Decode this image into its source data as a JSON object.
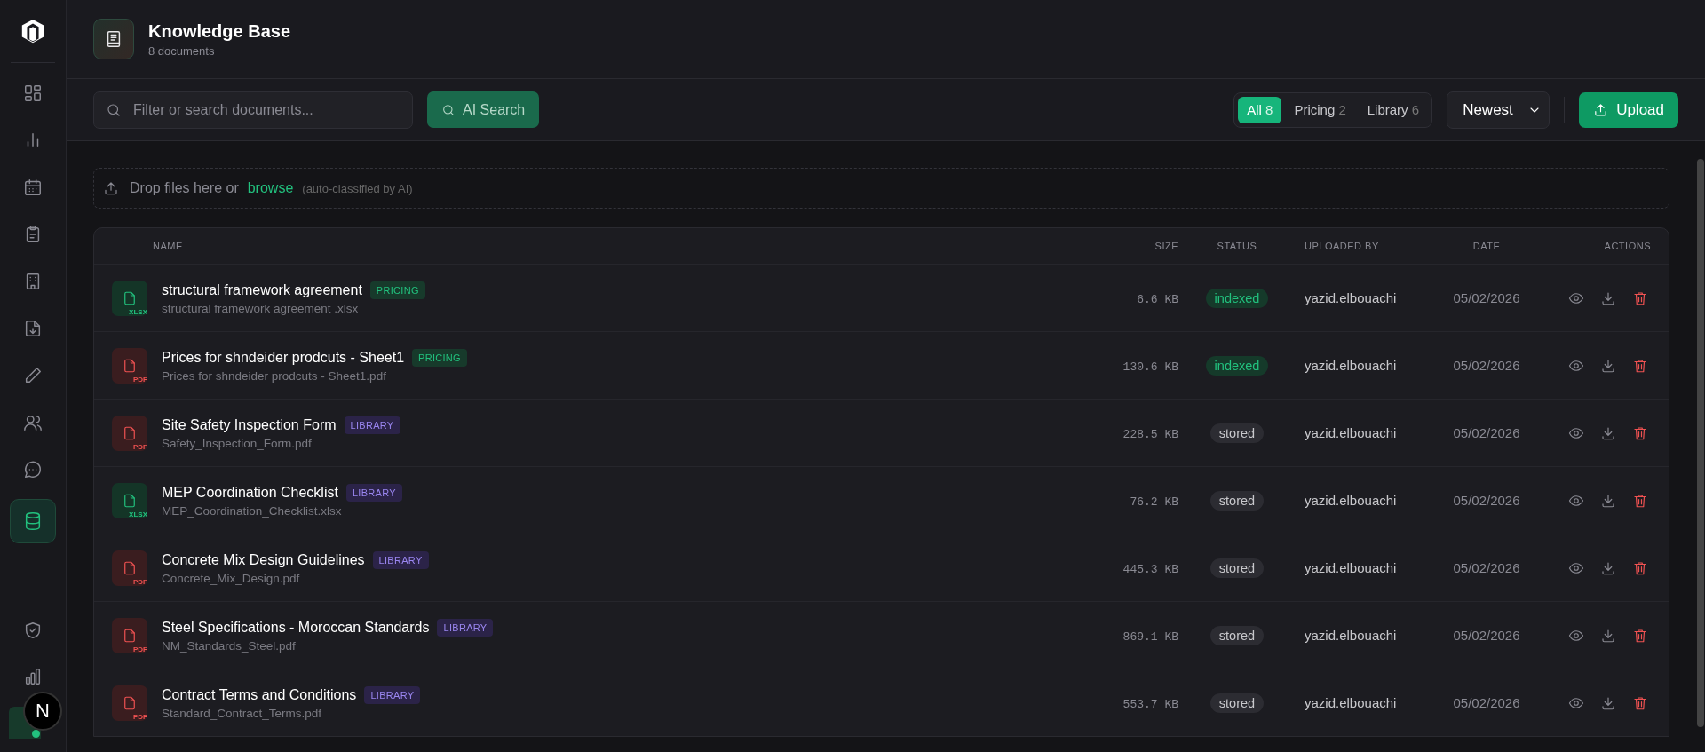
{
  "sidebar": {
    "items": [
      {
        "selected": false
      },
      {
        "selected": false
      },
      {
        "selected": false
      },
      {
        "selected": false
      },
      {
        "selected": false
      },
      {
        "selected": false
      },
      {
        "selected": false
      },
      {
        "selected": false
      },
      {
        "selected": false
      },
      {
        "selected": true
      }
    ],
    "bottom_items": [
      {
        "selected": false
      },
      {
        "selected": false
      }
    ],
    "avatar": {
      "initial": "N"
    }
  },
  "header": {
    "title": "Knowledge Base",
    "subtitle": "8 documents"
  },
  "toolbar": {
    "search": {
      "placeholder": "Filter or search documents..."
    },
    "ai_search": "AI Search",
    "filters": [
      {
        "label": "All",
        "count": "8",
        "selected": true
      },
      {
        "label": "Pricing",
        "count": "2",
        "selected": false
      },
      {
        "label": "Library",
        "count": "6",
        "selected": false
      }
    ],
    "sort": "Newest",
    "upload": "Upload"
  },
  "dropzone": {
    "text": "Drop files here or",
    "link": "browse",
    "note": "(auto-classified by AI)"
  },
  "table": {
    "columns": [
      "NAME",
      "SIZE",
      "STATUS",
      "UPLOADED BY",
      "DATE",
      "ACTIONS"
    ],
    "rows": [
      {
        "type": {
          "kind": "xlsx",
          "label": "XLSX"
        },
        "title": "structural framework agreement",
        "tag": {
          "kind": "pricing",
          "label": "PRICING"
        },
        "filename": "structural framework agreement .xlsx",
        "size": "6.6 KB",
        "status": {
          "kind": "indexed",
          "label": "indexed"
        },
        "uploaded_by": "yazid.elbouachi",
        "date": "05/02/2026"
      },
      {
        "type": {
          "kind": "pdf",
          "label": "PDF"
        },
        "title": "Prices for shndeider prodcuts - Sheet1",
        "tag": {
          "kind": "pricing",
          "label": "PRICING"
        },
        "filename": "Prices for shndeider prodcuts - Sheet1.pdf",
        "size": "130.6 KB",
        "status": {
          "kind": "indexed",
          "label": "indexed"
        },
        "uploaded_by": "yazid.elbouachi",
        "date": "05/02/2026"
      },
      {
        "type": {
          "kind": "pdf",
          "label": "PDF"
        },
        "title": "Site Safety Inspection Form",
        "tag": {
          "kind": "library",
          "label": "LIBRARY"
        },
        "filename": "Safety_Inspection_Form.pdf",
        "size": "228.5 KB",
        "status": {
          "kind": "stored",
          "label": "stored"
        },
        "uploaded_by": "yazid.elbouachi",
        "date": "05/02/2026"
      },
      {
        "type": {
          "kind": "xlsx",
          "label": "XLSX"
        },
        "title": "MEP Coordination Checklist",
        "tag": {
          "kind": "library",
          "label": "LIBRARY"
        },
        "filename": "MEP_Coordination_Checklist.xlsx",
        "size": "76.2 KB",
        "status": {
          "kind": "stored",
          "label": "stored"
        },
        "uploaded_by": "yazid.elbouachi",
        "date": "05/02/2026"
      },
      {
        "type": {
          "kind": "pdf",
          "label": "PDF"
        },
        "title": "Concrete Mix Design Guidelines",
        "tag": {
          "kind": "library",
          "label": "LIBRARY"
        },
        "filename": "Concrete_Mix_Design.pdf",
        "size": "445.3 KB",
        "status": {
          "kind": "stored",
          "label": "stored"
        },
        "uploaded_by": "yazid.elbouachi",
        "date": "05/02/2026"
      },
      {
        "type": {
          "kind": "pdf",
          "label": "PDF"
        },
        "title": "Steel Specifications - Moroccan Standards",
        "tag": {
          "kind": "library",
          "label": "LIBRARY"
        },
        "filename": "NM_Standards_Steel.pdf",
        "size": "869.1 KB",
        "status": {
          "kind": "stored",
          "label": "stored"
        },
        "uploaded_by": "yazid.elbouachi",
        "date": "05/02/2026"
      },
      {
        "type": {
          "kind": "pdf",
          "label": "PDF"
        },
        "title": "Contract Terms and Conditions",
        "tag": {
          "kind": "library",
          "label": "LIBRARY"
        },
        "filename": "Standard_Contract_Terms.pdf",
        "size": "553.7 KB",
        "status": {
          "kind": "stored",
          "label": "stored"
        },
        "uploaded_by": "yazid.elbouachi",
        "date": "05/02/2026"
      }
    ]
  }
}
